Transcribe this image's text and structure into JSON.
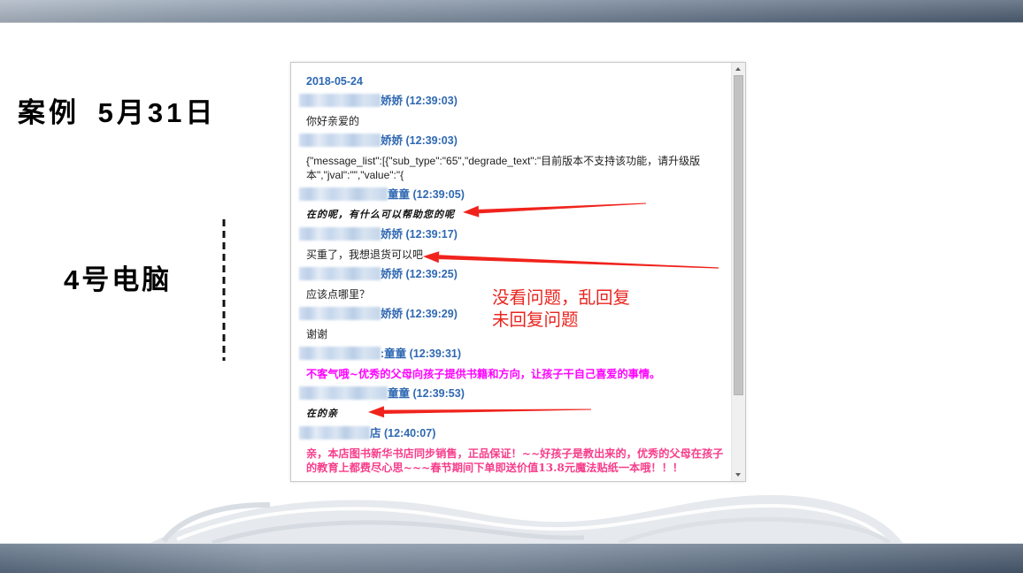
{
  "slide": {
    "title": "案例 5月31日",
    "label": "4号电脑"
  },
  "chat": {
    "date": "2018-05-24",
    "messages": [
      {
        "sender": "娇娇",
        "time": "(12:39:03)",
        "lines": [
          "你好亲爱的"
        ]
      },
      {
        "sender": "娇娇",
        "time": "(12:39:03)",
        "lines": [
          "{\"message_list\":[{\"sub_type\":\"65\",\"degrade_text\":\"目前版本不支持该功能，请升级版",
          "本\",\"jval\":\"\",\"value\":\"{"
        ]
      },
      {
        "sender": "童童",
        "time": "(12:39:05)",
        "lines": [
          "在的呢，有什么可以帮助您的呢"
        ]
      },
      {
        "sender": "娇娇",
        "time": "(12:39:17)",
        "lines": [
          "买重了，我想退货可以吧"
        ]
      },
      {
        "sender": "娇娇",
        "time": "(12:39:25)",
        "lines": [
          "应该点哪里？"
        ]
      },
      {
        "sender": "娇娇",
        "time": "(12:39:29)",
        "lines": [
          "谢谢"
        ]
      },
      {
        "sender": ":童童",
        "time": "(12:39:31)",
        "lines": [
          "不客气哦~优秀的父母向孩子提供书籍和方向，让孩子干自己喜爱的事情。"
        ]
      },
      {
        "sender": "童童",
        "time": "(12:39:53)",
        "lines": [
          "在的亲"
        ]
      },
      {
        "sender": "店",
        "time": "(12:40:07)",
        "lines": [
          "亲，本店图书新华书店同步销售，正品保证！~~好孩子是教出来的，优秀的父母在孩子",
          "的教育上都费尽心思~~~春节期间下单即送价值13.8元魔法贴纸一本哦！！！"
        ]
      }
    ]
  },
  "annotation": {
    "lines": [
      "没看问题，乱回复",
      "未回复问题"
    ]
  },
  "colors": {
    "header_blue": "#2f68b2",
    "magenta": "#ff00ff",
    "pink": "#f73d8b",
    "annotation_red": "#e8251f",
    "arrow_red": "#f0231c"
  }
}
